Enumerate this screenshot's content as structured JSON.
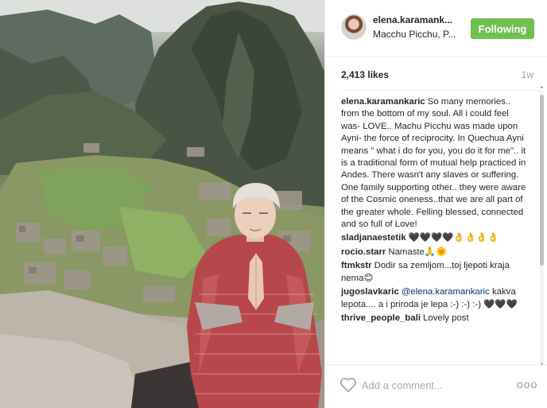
{
  "post": {
    "photo_alt": "Woman meditating at Machu Picchu",
    "username": "elena.karamank...",
    "location": "Macchu Picchu, P...",
    "follow_label": "Following",
    "likes": "2,413 likes",
    "age": "1w"
  },
  "comments": [
    {
      "user": "elena.karamankaric",
      "parts": [
        {
          "t": "So many memories.. from the bottom of my soul. All i could feel was- LOVE.. Machu Picchu was made upon Ayni- the force of reciprocity. In Quechua Ayni means \" what i do for you, you do it for me\".. it is a traditional form of mutual help practiced in Andes. There wasn't any slaves or suffering. One family supporting other.. they were aware of the Cosmic oneness..that we are all part of the greater whole. Felling blessed, connected and so full of Love!"
        }
      ]
    },
    {
      "user": "sladjanaestetik",
      "parts": [
        {
          "t": "🖤🖤🖤🖤👌👌👌👌"
        }
      ]
    },
    {
      "user": "rocio.starr",
      "parts": [
        {
          "t": "Namaste🙏🌞"
        }
      ]
    },
    {
      "user": "ftmkstr",
      "parts": [
        {
          "t": "Dodir sa zemljom...toj ljepoti kraja nema😊"
        }
      ]
    },
    {
      "user": "jugoslavkaric",
      "parts": [
        {
          "t": "@elena.karamankaric",
          "mention": true
        },
        {
          "t": " kakva lepota.... a i priroda je lepa :-) :-) :-) 🖤🖤🖤"
        }
      ]
    },
    {
      "user": "thrive_people_bali",
      "parts": [
        {
          "t": "Lovely post"
        }
      ]
    }
  ],
  "footer": {
    "comment_placeholder": "Add a comment...",
    "more_label": "ooo"
  },
  "colors": {
    "follow_green": "#70c050",
    "mention_blue": "#003569",
    "muted": "#999999"
  },
  "icons": [
    "heart-icon",
    "more-options-icon"
  ]
}
